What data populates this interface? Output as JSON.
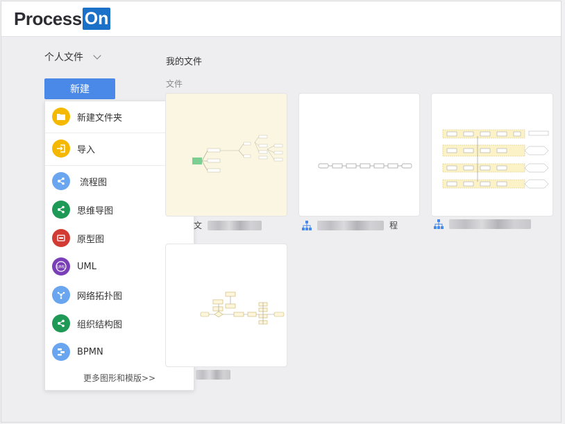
{
  "app": {
    "logo_text": "Process",
    "logo_badge": "On",
    "brand_color": "#1b70c8",
    "accent_color": "#4a89e8"
  },
  "sidebar": {
    "workspace_label": "个人文件",
    "new_button_label": "新建"
  },
  "new_menu": {
    "items": [
      {
        "label": "新建文件夹",
        "icon": "folder-icon",
        "color": "#f5b800"
      },
      {
        "label": "导入",
        "icon": "import-icon",
        "color": "#f5b800"
      },
      {
        "label": "流程图",
        "icon": "flowchart-icon",
        "color": "#6aa5f0"
      },
      {
        "label": "思维导图",
        "icon": "mindmap-icon",
        "color": "#1f9a56"
      },
      {
        "label": "原型图",
        "icon": "prototype-icon",
        "color": "#d23b33"
      },
      {
        "label": "UML",
        "icon": "uml-icon",
        "color": "#7a3fb8"
      },
      {
        "label": "网络拓扑图",
        "icon": "network-icon",
        "color": "#6aa5f0"
      },
      {
        "label": "组织结构图",
        "icon": "orgchart-icon",
        "color": "#1f9a56"
      },
      {
        "label": "BPMN",
        "icon": "bpmn-icon",
        "color": "#6aa5f0"
      }
    ],
    "more_link": "更多图形和模版>>"
  },
  "main": {
    "breadcrumb": "我的文件",
    "section_label": "文件",
    "files": [
      {
        "caption_visible": "文",
        "caption_suffix": "",
        "type_icon": "mindmap-file-icon"
      },
      {
        "caption_visible": "",
        "caption_suffix": "程",
        "type_icon": "flowchart-file-icon"
      },
      {
        "caption_visible": "",
        "caption_suffix": "",
        "type_icon": "flowchart-file-icon"
      },
      {
        "caption_visible": "",
        "caption_suffix": "",
        "type_icon": "flowchart-file-icon"
      }
    ]
  }
}
